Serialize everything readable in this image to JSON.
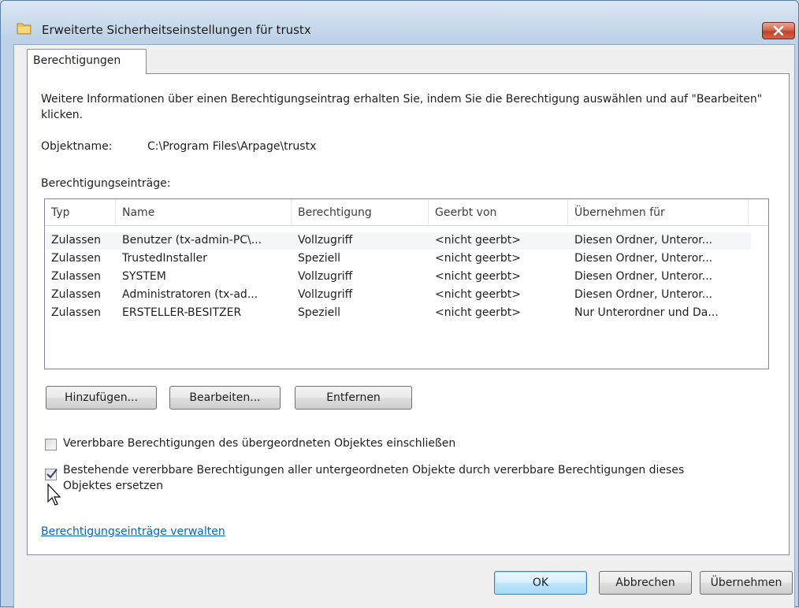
{
  "window": {
    "title": "Erweiterte Sicherheitseinstellungen für trustx",
    "close_label": "X"
  },
  "tab": {
    "label": "Berechtigungen"
  },
  "description": "Weitere Informationen über einen Berechtigungseintrag erhalten Sie, indem Sie die Berechtigung auswählen und auf \"Bearbeiten\" klicken.",
  "object": {
    "label": "Objektname:",
    "value": "C:\\Program Files\\Arpage\\trustx"
  },
  "entries_label": "Berechtigungseinträge:",
  "table": {
    "columns": [
      "Typ",
      "Name",
      "Berechtigung",
      "Geerbt von",
      "Übernehmen für"
    ],
    "rows": [
      [
        "Zulassen",
        "Benutzer (tx-admin-PC\\...",
        "Vollzugriff",
        "<nicht geerbt>",
        "Diesen Ordner, Unteror..."
      ],
      [
        "Zulassen",
        "TrustedInstaller",
        "Speziell",
        "<nicht geerbt>",
        "Diesen Ordner, Unteror..."
      ],
      [
        "Zulassen",
        "SYSTEM",
        "Vollzugriff",
        "<nicht geerbt>",
        "Diesen Ordner, Unteror..."
      ],
      [
        "Zulassen",
        "Administratoren (tx-ad...",
        "Vollzugriff",
        "<nicht geerbt>",
        "Diesen Ordner, Unteror..."
      ],
      [
        "Zulassen",
        "ERSTELLER-BESITZER",
        "Speziell",
        "<nicht geerbt>",
        "Nur Unterordner und Da..."
      ]
    ]
  },
  "buttons": {
    "add": "Hinzufügen...",
    "edit": "Bearbeiten...",
    "remove": "Entfernen",
    "ok": "OK",
    "cancel": "Abbrechen",
    "apply": "Übernehmen"
  },
  "checkboxes": {
    "include_inheritable": {
      "label": "Vererbbare Berechtigungen des übergeordneten Objektes einschließen",
      "checked": false
    },
    "replace_child": {
      "label_line1": "Bestehende vererbbare Berechtigungen aller untergeordneten Objekte durch vererbbare Berechtigungen dieses",
      "label_line2": "Objektes ersetzen",
      "checked": true
    }
  },
  "manage_link": "Berechtigungseinträge verwalten",
  "colors": {
    "link": "#0066cc",
    "default_button_border": "#3c7fb1",
    "close_button": "#c2412a"
  },
  "icons": {
    "title": "folder-icon",
    "close": "close-x-icon",
    "cursor": "mouse-pointer-icon"
  }
}
